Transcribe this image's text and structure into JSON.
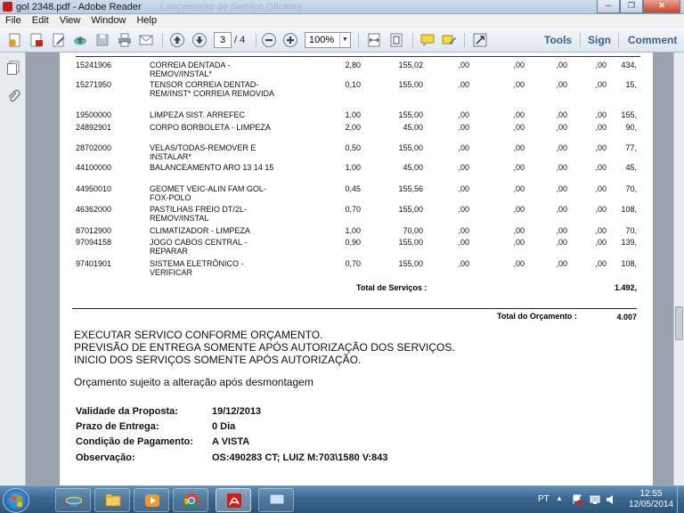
{
  "window": {
    "title": "gol 2348.pdf - Adobe Reader",
    "ghost_title": "Lançamento de Serviço Oficinas",
    "min_glyph": "─",
    "max_glyph": "❐",
    "close_glyph": "✕"
  },
  "menu": [
    "File",
    "Edit",
    "View",
    "Window",
    "Help"
  ],
  "toolbar": {
    "current_page": "3",
    "total_pages": "/ 4",
    "zoom": "100%",
    "tools_label": "Tools",
    "sign_label": "Sign",
    "comment_label": "Comment"
  },
  "rows": [
    {
      "code": "15241906",
      "desc": "CORREIA DENTADA - REMOV/INSTAL*",
      "qty": "2,80",
      "unit": "155,02",
      "a": ",00",
      "b": ",00",
      "c": ",00",
      "d": ",00",
      "e": "434,"
    },
    {
      "code": "15271950",
      "desc": "TENSOR CORREIA DENTAD-REM/INST* CORREIA REMOVIDA",
      "qty": "0,10",
      "unit": "155,00",
      "a": ",00",
      "b": ",00",
      "c": ",00",
      "d": ",00",
      "e": "15,"
    },
    {
      "code": "19500000",
      "desc": "LIMPEZA SIST. ARREFEC",
      "qty": "1,00",
      "unit": "155,00",
      "a": ",00",
      "b": ",00",
      "c": ",00",
      "d": ",00",
      "e": "155,"
    },
    {
      "code": "24892901",
      "desc": "CORPO BORBOLETA - LIMPEZA",
      "qty": "2,00",
      "unit": "45,00",
      "a": ",00",
      "b": ",00",
      "c": ",00",
      "d": ",00",
      "e": "90,"
    },
    {
      "code": "28702000",
      "desc": "VELAS/TODAS-REMOVER E INSTALAR*",
      "qty": "0,50",
      "unit": "155,00",
      "a": ",00",
      "b": ",00",
      "c": ",00",
      "d": ",00",
      "e": "77,"
    },
    {
      "code": "44100000",
      "desc": "BALANCEAMENTO ARO 13 14 15",
      "qty": "1,00",
      "unit": "45,00",
      "a": ",00",
      "b": ",00",
      "c": ",00",
      "d": ",00",
      "e": "45,"
    },
    {
      "code": "44950010",
      "desc": "GEOMET VEIC-ALIN FAM GOL-FOX-POLO",
      "qty": "0,45",
      "unit": "155,56",
      "a": ",00",
      "b": ",00",
      "c": ",00",
      "d": ",00",
      "e": "70,"
    },
    {
      "code": "46362000",
      "desc": "PASTILHAS FREIO DT/2L-REMOV/INSTAL",
      "qty": "0,70",
      "unit": "155,00",
      "a": ",00",
      "b": ",00",
      "c": ",00",
      "d": ",00",
      "e": "108,"
    },
    {
      "code": "87012900",
      "desc": "CLIMATIZADOR - LIMPEZA",
      "qty": "1,00",
      "unit": "70,00",
      "a": ",00",
      "b": ",00",
      "c": ",00",
      "d": ",00",
      "e": "70,"
    },
    {
      "code": "97094158",
      "desc": "JOGO CABOS CENTRAL - REPARAR",
      "qty": "0,90",
      "unit": "155,00",
      "a": ",00",
      "b": ",00",
      "c": ",00",
      "d": ",00",
      "e": "139,"
    },
    {
      "code": "97401901",
      "desc": "SISTEMA ELETRÔNICO - VERIFICAR",
      "qty": "0,70",
      "unit": "155,00",
      "a": ",00",
      "b": ",00",
      "c": ",00",
      "d": ",00",
      "e": "108,"
    }
  ],
  "totals": {
    "servicos_label": "Total de Serviços :",
    "servicos_value": "1.492,",
    "orcamento_label": "Total do Orçamento :",
    "orcamento_value": "4.007"
  },
  "notes": [
    "EXECUTAR SERVICO CONFORME ORÇAMENTO.",
    "PREVISÃO DE ENTREGA SOMENTE APÓS AUTORIZAÇÃO DOS SERVIÇOS.",
    "INICIO DOS SERVIÇOS SOMENTE APÓS AUTORIZAÇÃO.",
    "Orçamento sujeito a alteração após desmontagem"
  ],
  "fields": [
    {
      "label": "Validade da Proposta:",
      "value": "19/12/2013"
    },
    {
      "label": "Prazo de Entrega:",
      "value": "0 Dia"
    },
    {
      "label": "Condição de Pagamento:",
      "value": "A VISTA"
    },
    {
      "label": "Observação:",
      "value": "OS:490283  CT; LUIZ  M:703\\1580  V:843"
    }
  ],
  "taskbar": {
    "lang": "PT",
    "time": "12:55",
    "date": "12/05/2014"
  }
}
